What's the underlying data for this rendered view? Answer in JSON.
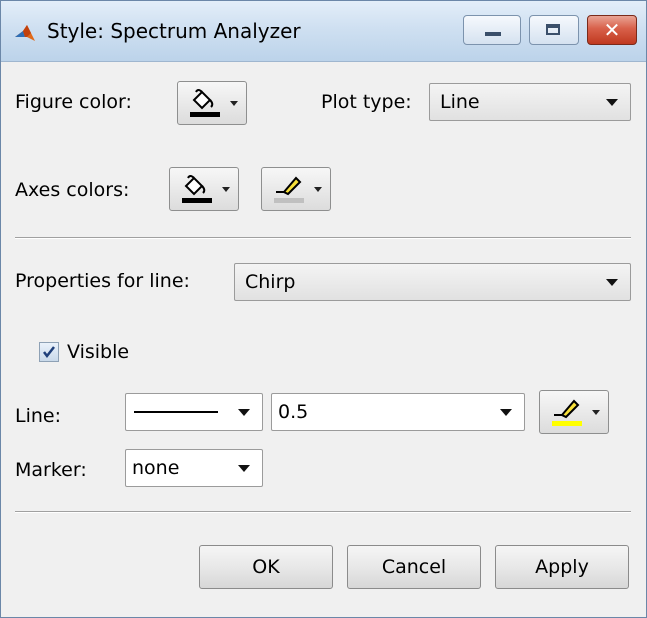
{
  "window": {
    "title": "Style: Spectrum Analyzer",
    "icon": "matlab-icon",
    "controls": [
      "minimize-icon",
      "maximize-icon",
      "close-icon"
    ]
  },
  "figure": {
    "color_label": "Figure color:",
    "color_icon": "paint-bucket-icon",
    "plot_type_label": "Plot type:",
    "plot_type_value": "Line"
  },
  "axes": {
    "colors_label": "Axes colors:",
    "fill_icon": "paint-bucket-icon",
    "line_icon": "pen-icon"
  },
  "line_props": {
    "properties_label": "Properties for line:",
    "selected_line": "Chirp",
    "visible_label": "Visible",
    "visible_checked": true,
    "line_label": "Line:",
    "line_style": "solid",
    "line_width": "0.5",
    "line_color": "#ffff00",
    "marker_label": "Marker:",
    "marker_value": "none"
  },
  "buttons": {
    "ok": "OK",
    "cancel": "Cancel",
    "apply": "Apply"
  },
  "colors": {
    "figure_swatch": "#000000",
    "axes_fill_swatch": "#000000",
    "axes_line_swatch": "#c0c0c0",
    "line_swatch": "#ffff00"
  }
}
